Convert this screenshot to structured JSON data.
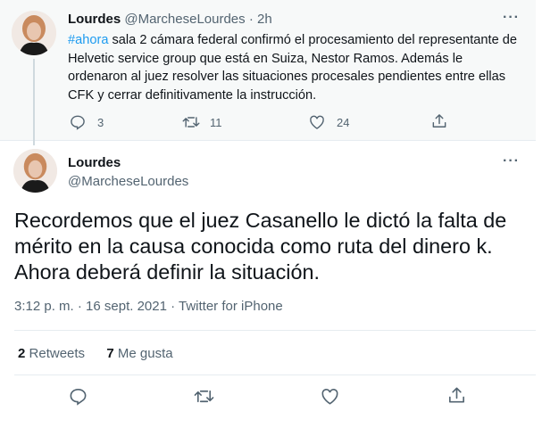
{
  "parent_tweet": {
    "display_name": "Lourdes",
    "handle": "@MarcheseLourdes",
    "separator": "·",
    "time": "2h",
    "hashtag": "#ahora",
    "text": " sala 2 cámara federal confirmó el procesamiento del representante de Helvetic service group que está en Suiza, Nestor Ramos. Además le ordenaron al juez resolver las situaciones procesales pendientes entre ellas CFK y cerrar definitivamente la instrucción.",
    "reply_count": "3",
    "retweet_count": "11",
    "like_count": "24",
    "more_label": "···"
  },
  "main_tweet": {
    "display_name": "Lourdes",
    "handle": "@MarcheseLourdes",
    "more_label": "···",
    "text": "Recordemos que el juez Casanello le dictó la falta de mérito en la causa conocida como ruta del dinero k. Ahora deberá definir la situación.",
    "timestamp": "3:12 p. m. · 16 sept. 2021 · Twitter for iPhone",
    "retweets_count": "2",
    "retweets_label": "Retweets",
    "likes_count": "7",
    "likes_label": "Me gusta"
  },
  "colors": {
    "accent": "#1d9bf0",
    "muted": "#536471",
    "text": "#0f1419",
    "parent_bg": "#f7f9f9"
  },
  "icons": [
    "reply-icon",
    "retweet-icon",
    "like-icon",
    "share-icon",
    "more-icon"
  ]
}
